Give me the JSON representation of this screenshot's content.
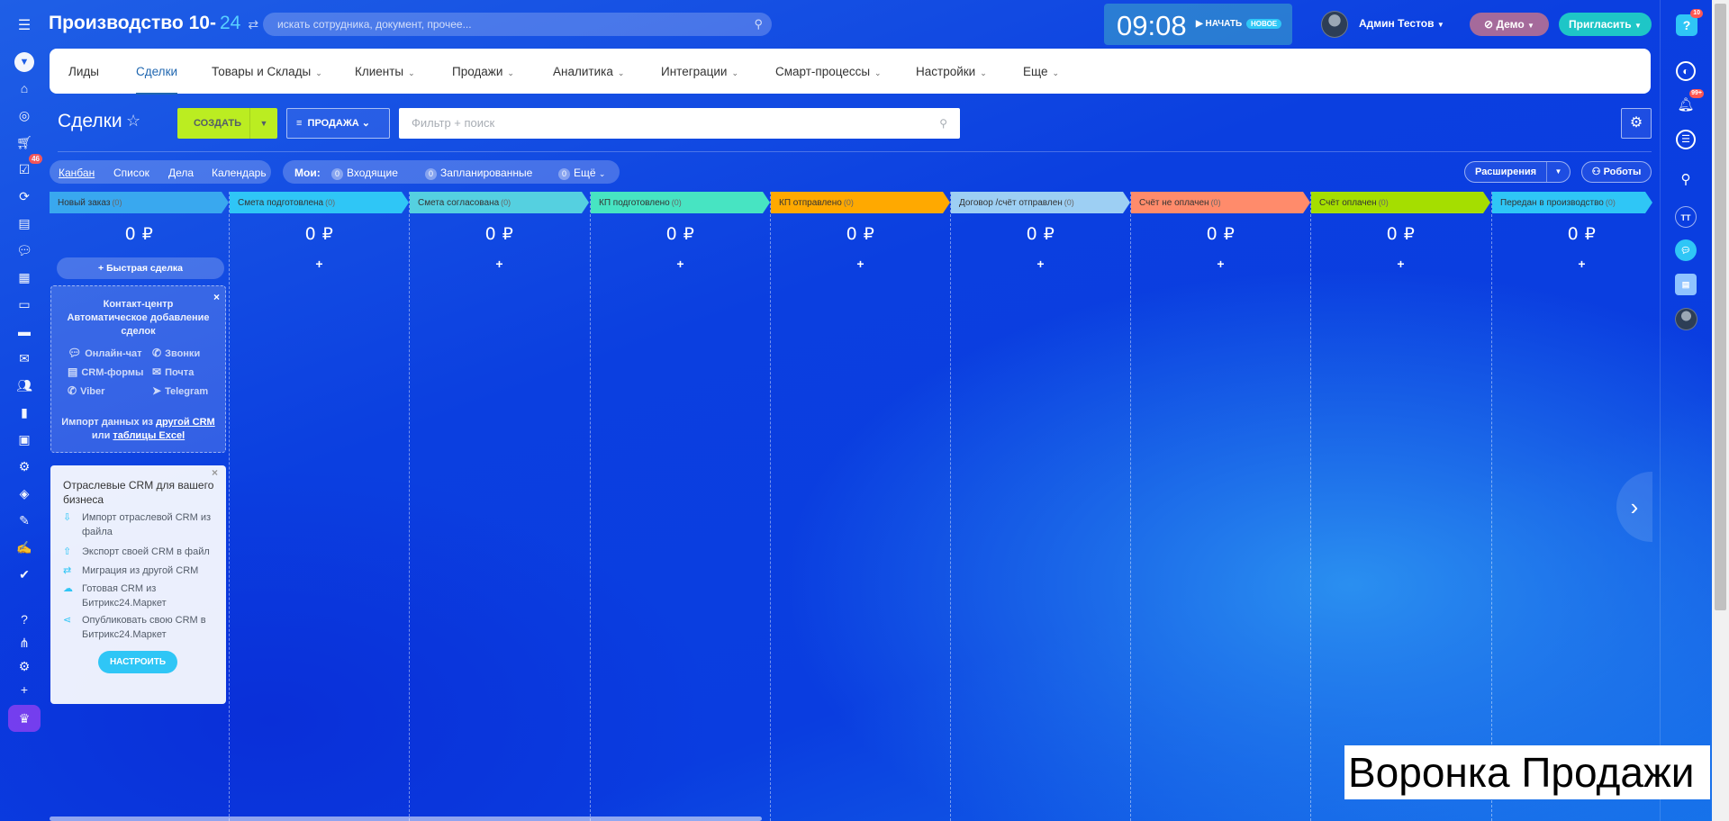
{
  "app": {
    "title": "Производство 10-",
    "title_num": "24",
    "switch_icon": "⇄"
  },
  "search": {
    "placeholder": "искать сотрудника, документ, прочее..."
  },
  "clock": {
    "time": "09:08",
    "start_label": "НАЧАТЬ",
    "new_badge": "НОВОЕ"
  },
  "user": {
    "name": "Админ Тестов"
  },
  "demo": {
    "label": "Демо"
  },
  "invite": {
    "label": "Пригласить"
  },
  "help": {
    "label": "?",
    "badge": "10"
  },
  "left_sidebar": {
    "tasks_badge": "46"
  },
  "nav": {
    "items": [
      "Лиды",
      "Сделки",
      "Товары и Склады",
      "Клиенты",
      "Продажи",
      "Аналитика",
      "Интеграции",
      "Смарт-процессы",
      "Настройки",
      "Еще"
    ]
  },
  "page": {
    "title": "Сделки"
  },
  "toolbar": {
    "create_label": "СОЗДАТЬ",
    "funnel_label": "ПРОДАЖА",
    "filter_placeholder": "Фильтр + поиск"
  },
  "views": {
    "items": [
      "Канбан",
      "Список",
      "Дела",
      "Календарь"
    ]
  },
  "counters": {
    "label": "Мои:",
    "incoming": "Входящие",
    "planned": "Запланированные",
    "more": "Ещё",
    "incoming_count": "0",
    "planned_count": "0",
    "more_count": "0"
  },
  "extensions": {
    "label": "Расширения"
  },
  "robots": {
    "label": "Роботы"
  },
  "columns": [
    {
      "name": "Новый заказ",
      "count": "(0)",
      "sum": "0 ₽",
      "color": "#39a8ef"
    },
    {
      "name": "Смета подготовлена",
      "count": "(0)",
      "sum": "0 ₽",
      "color": "#2fc6f6"
    },
    {
      "name": "Смета согласована",
      "count": "(0)",
      "sum": "0 ₽",
      "color": "#55d0e0"
    },
    {
      "name": "КП подготовлено",
      "count": "(0)",
      "sum": "0 ₽",
      "color": "#47e4c2"
    },
    {
      "name": "КП отправлено",
      "count": "(0)",
      "sum": "0 ₽",
      "color": "#ffa900"
    },
    {
      "name": "Договор /счёт отправлен",
      "count": "(0)",
      "sum": "0 ₽",
      "color": "#9dcff3"
    },
    {
      "name": "Счёт не оплачен",
      "count": "(0)",
      "sum": "0 ₽",
      "color": "#ff8b6b"
    },
    {
      "name": "Счёт оплачен",
      "count": "(0)",
      "sum": "0 ₽",
      "color": "#a5de00"
    },
    {
      "name": "Передан в производство",
      "count": "(0)",
      "sum": "0 ₽",
      "color": "#2fc6f6"
    }
  ],
  "quick_deal": {
    "label": "+ Быстрая сделка"
  },
  "contact_center": {
    "title_line1": "Контакт-центр",
    "title_line2": "Автоматическое добавление",
    "title_line3": "сделок",
    "channels": [
      "Онлайн-чат",
      "Звонки",
      "CRM-формы",
      "Почта",
      "Viber",
      "Telegram"
    ],
    "import_prefix": "Импорт данных из",
    "import_link1": "другой CRM",
    "import_or": "или",
    "import_link2": "таблицы Excel"
  },
  "industry": {
    "title": "Отраслевые CRM для вашего бизнеса",
    "items": [
      "Импорт отраслевой CRM из файла",
      "Экспорт своей CRM в файл",
      "Миграция из другой CRM",
      "Готовая CRM из Битрикс24.Маркет",
      "Опубликовать свою CRM в Битрикс24.Маркет"
    ],
    "button": "НАСТРОИТЬ"
  },
  "right_sidebar": {
    "notif_badge": "99+",
    "tt_label": "ТТ"
  },
  "caption": {
    "text": "Воронка Продажи"
  }
}
